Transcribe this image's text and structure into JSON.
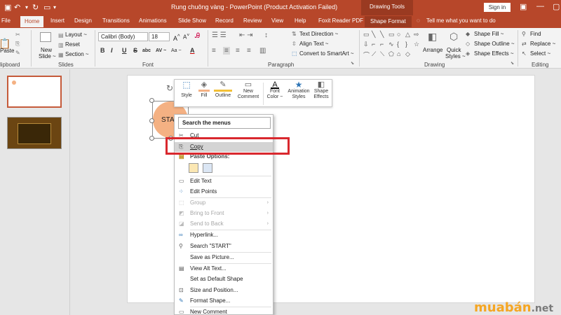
{
  "window": {
    "title": "Rung chuông vàng  -  PowerPoint (Product Activation Failed)",
    "context_tab_group": "Drawing Tools",
    "sign_in": "Sign in"
  },
  "tabs": [
    {
      "label": "File"
    },
    {
      "label": "Home"
    },
    {
      "label": "Insert"
    },
    {
      "label": "Design"
    },
    {
      "label": "Transitions"
    },
    {
      "label": "Animations"
    },
    {
      "label": "Slide Show"
    },
    {
      "label": "Record"
    },
    {
      "label": "Review"
    },
    {
      "label": "View"
    },
    {
      "label": "Help"
    },
    {
      "label": "Foxit Reader PDF"
    },
    {
      "label": "Shape Format"
    }
  ],
  "tell_me": "Tell me what you want to do",
  "ribbon": {
    "clipboard": {
      "paste": "Paste",
      "group": "lipboard"
    },
    "slides": {
      "new_slide": "New",
      "new_slide2": "Slide ~",
      "layout": "Layout ~",
      "reset": "Reset",
      "section": "Section ~",
      "group": "Slides"
    },
    "font": {
      "font_name": "Calibri (Body)",
      "font_size": "18",
      "bold": "B",
      "italic": "I",
      "underline": "U",
      "strike": "S",
      "shadow": "abc",
      "spacing": "AV ~",
      "case": "Aa ~",
      "color": "A",
      "group": "Font"
    },
    "paragraph": {
      "text_direction": "Text Direction ~",
      "align_text": "Align Text ~",
      "convert_smartart": "Convert to SmartArt ~",
      "group": "Paragraph"
    },
    "drawing": {
      "arrange": "Arrange",
      "quick_styles": "Quick",
      "quick_styles2": "Styles ~",
      "shape_fill": "Shape Fill ~",
      "shape_outline": "Shape Outline ~",
      "shape_effects": "Shape Effects ~",
      "group": "Drawing"
    },
    "editing": {
      "find": "Find",
      "replace": "Replace ~",
      "select": "Select ~",
      "group": "Editing"
    }
  },
  "slide_shape_text": "STAR",
  "mini_toolbar": {
    "style": "Style",
    "fill": "Fill",
    "outline": "Outline",
    "new_comment": "New",
    "new_comment2": "Comment",
    "font_color": "Font",
    "font_color2": "Color ~",
    "animation_styles": "Animation",
    "animation_styles2": "Styles",
    "shape_effects": "Shape",
    "shape_effects2": "Effects"
  },
  "context_menu": {
    "search_placeholder": "Search the menus",
    "items": {
      "cut": "Cut",
      "copy": "Copy",
      "paste_options": "Paste Options:",
      "edit_text": "Edit Text",
      "edit_points": "Edit Points",
      "group": "Group",
      "bring_front": "Bring to Front",
      "send_back": "Send to Back",
      "hyperlink": "Hyperlink...",
      "search": "Search \"START\"",
      "save_picture": "Save as Picture...",
      "alt_text": "View Alt Text...",
      "default_shape": "Set as Default Shape",
      "size_position": "Size and Position...",
      "format_shape": "Format Shape...",
      "new_comment": "New Comment"
    }
  },
  "watermark": {
    "part1": "muabán",
    "part2": ".net"
  },
  "colors": {
    "accent": "#b7472a",
    "highlight_box": "#d9282e",
    "shape_fill": "#f4b183",
    "watermark_orange": "#f5a623",
    "watermark_gray": "#7a7a7a"
  }
}
